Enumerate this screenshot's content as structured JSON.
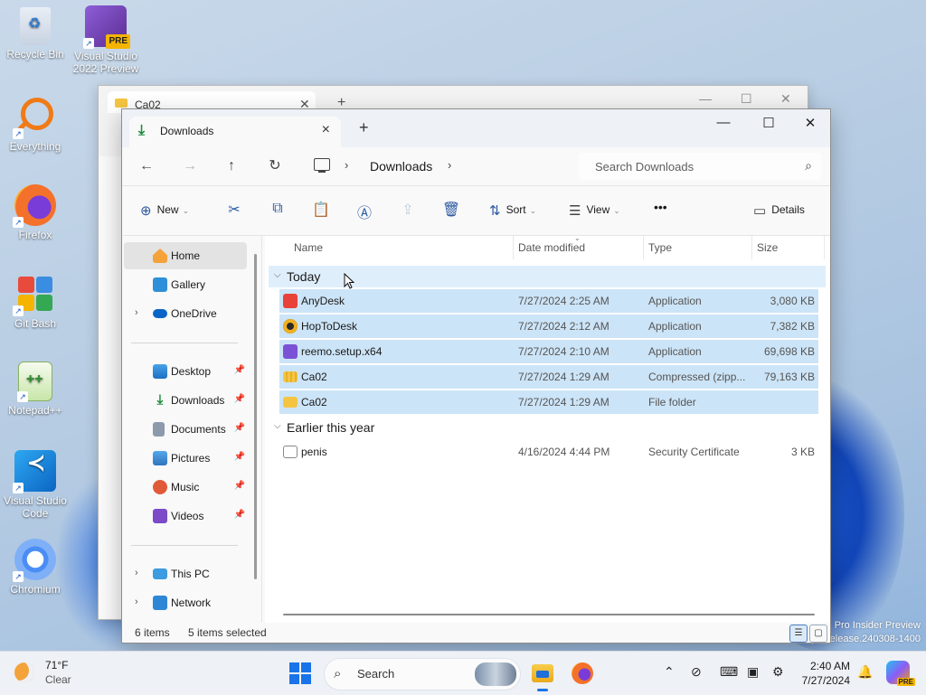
{
  "desktop": {
    "icons": [
      {
        "label_line1": "Recycle Bin",
        "label_line2": ""
      },
      {
        "label_line1": "Visual Studio",
        "label_line2": "2022 Preview",
        "badge": "PRE"
      },
      {
        "label_line1": "Everything",
        "label_line2": ""
      },
      {
        "label_line1": "Firefox",
        "label_line2": ""
      },
      {
        "label_line1": "Git Bash",
        "label_line2": ""
      },
      {
        "label_line1": "Notepad++",
        "label_line2": ""
      },
      {
        "label_line1": "Visual Studio",
        "label_line2": "Code"
      },
      {
        "label_line1": "Chromium",
        "label_line2": ""
      }
    ],
    "watermark_line1": "Pro Insider Preview",
    "watermark_line2": "Evaluation copy. Build 26100.ge_release.240308-1400"
  },
  "back_window": {
    "tab_title": "Ca02"
  },
  "window": {
    "tab_title": "Downloads",
    "nav": {
      "current_folder": "Downloads",
      "search_placeholder": "Search Downloads"
    },
    "commands": {
      "new": "New",
      "sort": "Sort",
      "view": "View",
      "more": "•••",
      "details": "Details"
    },
    "nav_pane": {
      "home": "Home",
      "gallery": "Gallery",
      "onedrive": "OneDrive",
      "desktop": "Desktop",
      "downloads": "Downloads",
      "documents": "Documents",
      "pictures": "Pictures",
      "music": "Music",
      "videos": "Videos",
      "this_pc": "This PC",
      "network": "Network"
    },
    "columns": {
      "name": "Name",
      "date": "Date modified",
      "type": "Type",
      "size": "Size"
    },
    "groups": [
      {
        "label": "Today",
        "rows": [
          {
            "name": "AnyDesk",
            "date": "7/27/2024 2:25 AM",
            "type": "Application",
            "size": "3,080 KB",
            "selected": true
          },
          {
            "name": "HopToDesk",
            "date": "7/27/2024 2:12 AM",
            "type": "Application",
            "size": "7,382 KB",
            "selected": true
          },
          {
            "name": "reemo.setup.x64",
            "date": "7/27/2024 2:10 AM",
            "type": "Application",
            "size": "69,698 KB",
            "selected": true
          },
          {
            "name": "Ca02",
            "date": "7/27/2024 1:29 AM",
            "type": "Compressed (zipp...",
            "size": "79,163 KB",
            "selected": true
          },
          {
            "name": "Ca02",
            "date": "7/27/2024 1:29 AM",
            "type": "File folder",
            "size": "",
            "selected": true
          }
        ]
      },
      {
        "label": "Earlier this year",
        "rows": [
          {
            "name": "penis",
            "date": "4/16/2024 4:44 PM",
            "type": "Security Certificate",
            "size": "3 KB",
            "selected": false
          }
        ]
      }
    ],
    "status": {
      "count": "6 items",
      "selected": "5 items selected"
    }
  },
  "taskbar": {
    "weather_temp": "71°F",
    "weather_cond": "Clear",
    "search_label": "Search",
    "time": "2:40 AM",
    "date": "7/27/2024",
    "copilot_badge": "PRE"
  },
  "colors": {
    "accent": "#1a73e8",
    "selection": "#cce4f7",
    "downloads_green": "#1b8a3a"
  }
}
